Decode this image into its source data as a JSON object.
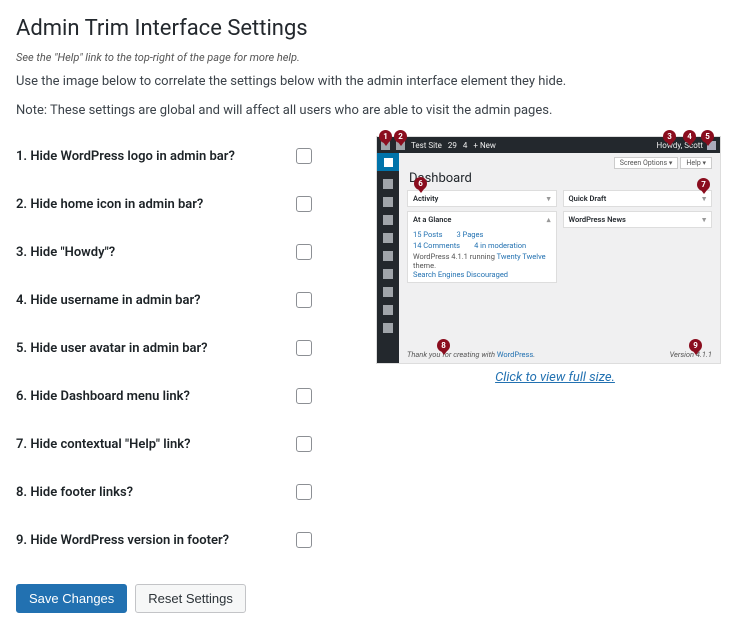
{
  "page": {
    "title": "Admin Trim Interface Settings",
    "help_hint": "See the \"Help\" link to the top-right of the page for more help.",
    "intro1": "Use the image below to correlate the settings below with the admin interface element they hide.",
    "intro2": "Note: These settings are global and will affect all users who are able to visit the admin pages."
  },
  "settings": [
    {
      "label": "1. Hide WordPress logo in admin bar?",
      "checked": false
    },
    {
      "label": "2. Hide home icon in admin bar?",
      "checked": false
    },
    {
      "label": "3. Hide \"Howdy\"?",
      "checked": false
    },
    {
      "label": "4. Hide username in admin bar?",
      "checked": false
    },
    {
      "label": "5. Hide user avatar in admin bar?",
      "checked": false
    },
    {
      "label": "6. Hide Dashboard menu link?",
      "checked": false
    },
    {
      "label": "7. Hide contextual \"Help\" link?",
      "checked": false
    },
    {
      "label": "8. Hide footer links?",
      "checked": false
    },
    {
      "label": "9. Hide WordPress version in footer?",
      "checked": false
    }
  ],
  "buttons": {
    "save": "Save Changes",
    "reset": "Reset Settings"
  },
  "link": {
    "view_full": "Click to view full size."
  },
  "screenshot": {
    "adminbar": {
      "site_name": "Test Site",
      "comments": "29",
      "updates": "4",
      "new": "+ New",
      "greeting": "Howdy, Scott"
    },
    "tabs": {
      "screen_options": "Screen Options ▾",
      "help": "Help ▾"
    },
    "heading": "Dashboard",
    "widgets": {
      "activity": "Activity",
      "quick_draft": "Quick Draft",
      "at_a_glance": "At a Glance",
      "wordpress_news": "WordPress News",
      "glance_posts": "15 Posts",
      "glance_pages": "3 Pages",
      "glance_comments": "14 Comments",
      "glance_moderation": "4 in moderation",
      "glance_theme_pre": "WordPress 4.1.1 running ",
      "glance_theme_link": "Twenty Twelve",
      "glance_theme_post": " theme.",
      "glance_se": "Search Engines Discouraged"
    },
    "footer": {
      "left_pre": "Thank you for creating with ",
      "left_link": "WordPress",
      "left_post": ".",
      "right": "Version 4.1.1"
    },
    "markers": {
      "m1": "1",
      "m2": "2",
      "m3": "3",
      "m4": "4",
      "m5": "5",
      "m6": "6",
      "m7": "7",
      "m8": "8",
      "m9": "9"
    }
  }
}
